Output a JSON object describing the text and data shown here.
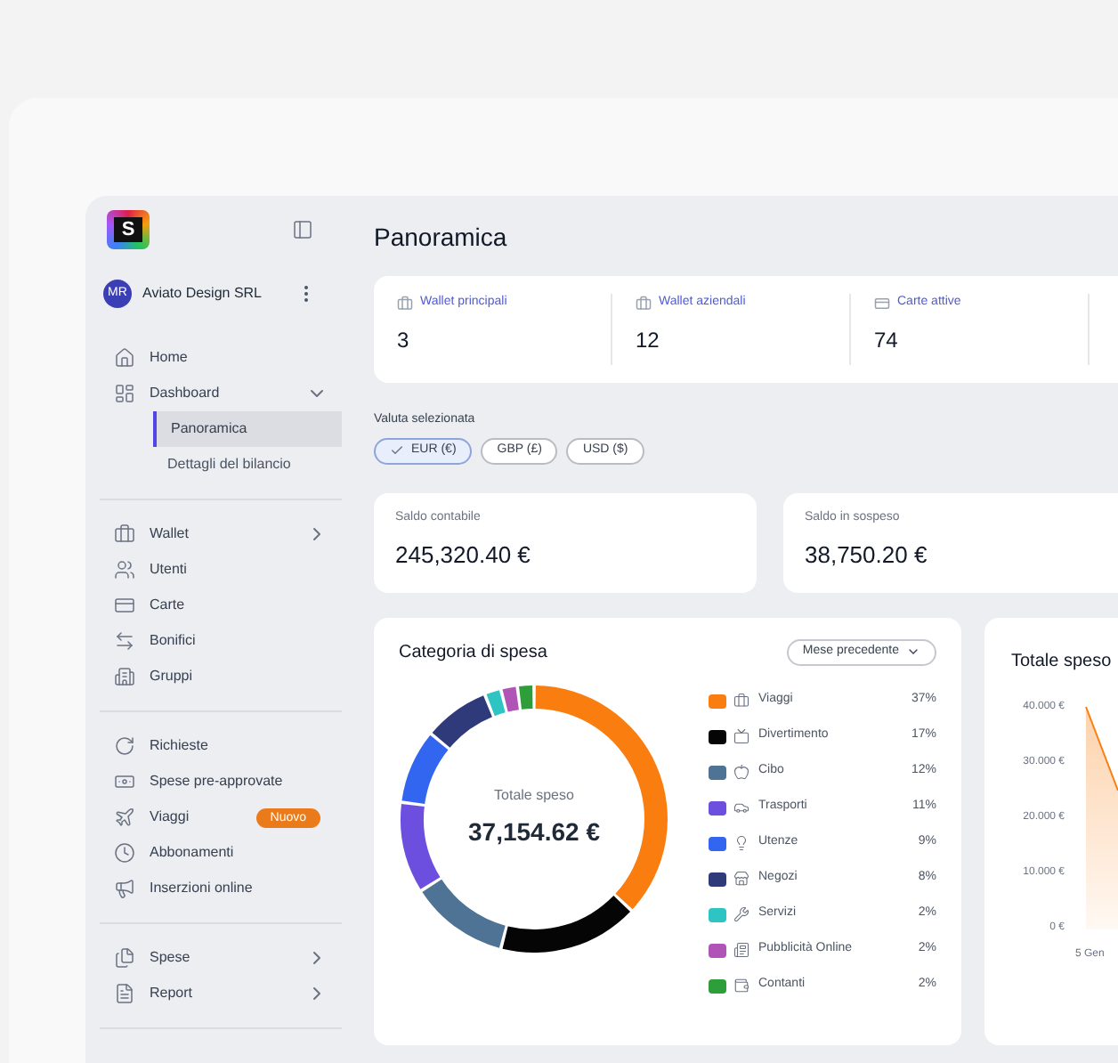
{
  "sidebar": {
    "logo": "S",
    "org": {
      "initials": "MR",
      "name": "Aviato Design SRL"
    },
    "sections": [
      [
        {
          "kind": "link",
          "label": "Home",
          "selected": false
        },
        {
          "kind": "menu",
          "label": "Dashboard",
          "selected": false,
          "expanded": true,
          "children": [
            {
              "label": "Panoramica",
              "selected": true
            },
            {
              "label": "Dettagli del bilancio",
              "selected": false
            }
          ]
        }
      ],
      [
        {
          "kind": "menu",
          "label": "Wallet",
          "selected": false,
          "expanded": false
        },
        {
          "kind": "link",
          "label": "Utenti",
          "selected": false
        },
        {
          "kind": "link",
          "label": "Carte",
          "selected": false
        },
        {
          "kind": "link",
          "label": "Bonifici",
          "selected": false
        },
        {
          "kind": "link",
          "label": "Gruppi",
          "selected": false
        }
      ],
      [
        {
          "kind": "link",
          "label": "Richieste",
          "selected": false
        },
        {
          "kind": "link",
          "label": "Spese pre-approvate",
          "selected": false
        },
        {
          "kind": "link",
          "label": "Viaggi",
          "selected": false,
          "badge": "Nuovo"
        },
        {
          "kind": "link",
          "label": "Abbonamenti",
          "selected": false
        },
        {
          "kind": "link",
          "label": "Inserzioni online",
          "selected": false
        }
      ],
      [
        {
          "kind": "menu",
          "label": "Spese",
          "selected": false,
          "expanded": false
        },
        {
          "kind": "menu",
          "label": "Report",
          "selected": false,
          "expanded": false
        }
      ]
    ]
  },
  "page_title": "Panoramica",
  "stats": [
    {
      "label": "Wallet principali",
      "value": "3"
    },
    {
      "label": "Wallet aziendali",
      "value": "12"
    },
    {
      "label": "Carte attive",
      "value": "74"
    }
  ],
  "currency": {
    "label": "Valuta selezionata",
    "options": [
      {
        "label": "EUR (€)",
        "selected": true
      },
      {
        "label": "GBP (£)",
        "selected": false
      },
      {
        "label": "USD ($)",
        "selected": false
      }
    ]
  },
  "balances": [
    {
      "label": "Saldo contabile",
      "value": "245,320.40 €"
    },
    {
      "label": "Saldo in sospeso",
      "value": "38,750.20 €"
    }
  ],
  "category_card": {
    "title": "Categoria di spesa",
    "period": "Mese precedente",
    "center_label": "Totale speso",
    "center_value": "37,154.62 €",
    "chart_data": {
      "type": "donut",
      "categories": [
        "Viaggi",
        "Divertimento",
        "Cibo",
        "Trasporti",
        "Utenze",
        "Negozi",
        "Servizi",
        "Pubblicità Online",
        "Contanti"
      ],
      "values": [
        37,
        17,
        12,
        11,
        9,
        8,
        2,
        2,
        2
      ]
    },
    "legend": [
      {
        "percent": "37%",
        "color": "#f97e0f"
      },
      {
        "percent": "17%",
        "color": "#050505"
      },
      {
        "percent": "12%",
        "color": "#4f7394"
      },
      {
        "percent": "11%",
        "color": "#6d4fe0"
      },
      {
        "percent": "9%",
        "color": "#3366f0"
      },
      {
        "percent": "8%",
        "color": "#2f3a7a"
      },
      {
        "percent": "2%",
        "color": "#2ec4c4"
      },
      {
        "percent": "2%",
        "color": "#b154b8"
      },
      {
        "percent": "2%",
        "color": "#2e9e3a"
      }
    ]
  },
  "total_card": {
    "title": "Totale speso",
    "y_labels": [
      "40.000 €",
      "30.000 €",
      "20.000 €",
      "10.000 €",
      "0 €"
    ],
    "x_labels": [
      "5 Gen"
    ]
  }
}
